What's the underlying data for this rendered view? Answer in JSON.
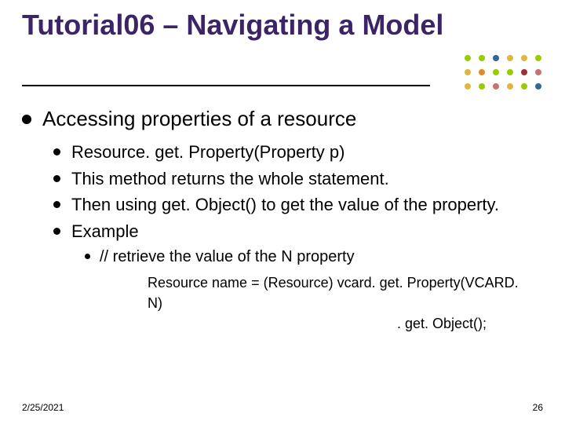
{
  "title": "Tutorial06 – Navigating a Model",
  "decor": {
    "dot_colors": {
      "lime": "#99cc00",
      "blue": "#336699",
      "gold": "#dfb73f",
      "orange": "#e08a2c",
      "red": "#993333",
      "pink": "#c97171"
    }
  },
  "l1": "Accessing properties of a resource",
  "l2": [
    "Resource. get. Property(Property p)",
    "This method returns the whole statement.",
    "Then using get. Object() to get the value of the property.",
    "Example"
  ],
  "l3": "// retrieve the value of the N property",
  "code": {
    "line1": "Resource name = (Resource) vcard. get. Property(VCARD. N)",
    "line2": ". get. Object();"
  },
  "footer": {
    "date": "2/25/2021",
    "page": "26"
  }
}
